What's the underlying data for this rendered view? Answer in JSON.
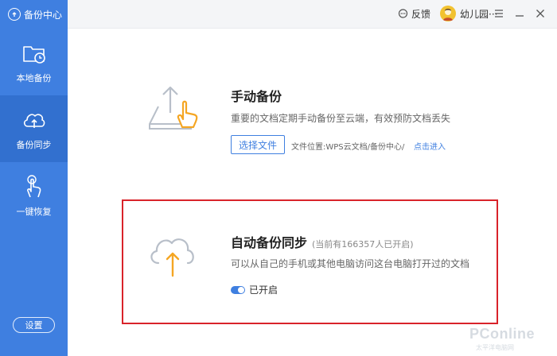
{
  "app": {
    "title": "备份中心"
  },
  "sidebar": {
    "items": [
      {
        "label": "本地备份",
        "icon": "folder-clock-icon",
        "active": false
      },
      {
        "label": "备份同步",
        "icon": "cloud-upload-icon",
        "active": true
      },
      {
        "label": "一键恢复",
        "icon": "hand-tap-icon",
        "active": false
      }
    ],
    "settings_label": "设置"
  },
  "topbar": {
    "feedback_label": "反馈",
    "user_name": "幼儿园···",
    "menu_icon": "hamburger-icon",
    "minimize_icon": "minimize-icon",
    "close_icon": "close-icon"
  },
  "manual_backup": {
    "title": "手动备份",
    "description": "重要的文档定期手动备份至云端，有效预防文档丢失",
    "button_label": "选择文件",
    "file_location": "文件位置:WPS云文档/备份中心/",
    "enter_link": "点击进入"
  },
  "auto_backup": {
    "title": "自动备份同步",
    "count_text": "(当前有166357人已开启)",
    "description": "可以从自己的手机或其他电脑访问这台电脑打开过的文档",
    "toggle_label": "已开启",
    "enabled": true
  },
  "colors": {
    "sidebar": "#3f7fe0",
    "sidebar_active": "#3270cf",
    "accent": "#3f7fe0",
    "highlight_border": "#d9232a",
    "orange": "#f5a623"
  },
  "watermark": {
    "brand": "PConline",
    "sub": "太平洋电脑网"
  }
}
